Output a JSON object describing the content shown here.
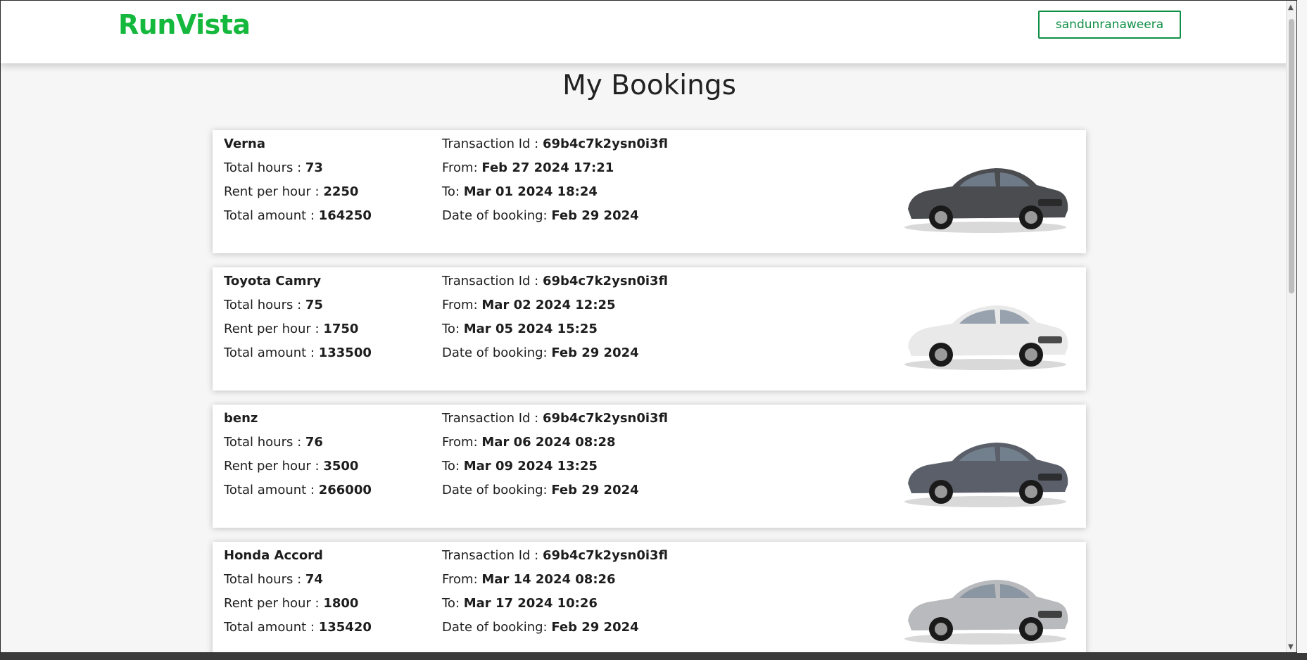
{
  "brand": {
    "name": "RunVista",
    "color": "#14b83c"
  },
  "header": {
    "user_label": "sandunranaweera"
  },
  "page": {
    "title": "My Bookings"
  },
  "labels": {
    "total_hours": "Total hours : ",
    "rent_per_hour": "Rent per hour : ",
    "total_amount": "Total amount : ",
    "transaction_id": "Transaction Id : ",
    "from": "From: ",
    "to": "To: ",
    "date_of_booking": "Date of booking: "
  },
  "bookings": [
    {
      "name": "Verna",
      "total_hours": "73",
      "rent_per_hour": "2250",
      "total_amount": "164250",
      "transaction_id": "69b4c7k2ysn0i3fl",
      "from": "Feb 27 2024 17:21",
      "to": "Mar 01 2024 18:24",
      "date_of_booking": "Feb 29 2024",
      "car_color": "#4a4c50",
      "car_icon": "dark-sedan-image"
    },
    {
      "name": "Toyota Camry",
      "total_hours": "75",
      "rent_per_hour": "1750",
      "total_amount": "133500",
      "transaction_id": "69b4c7k2ysn0i3fl",
      "from": "Mar 02 2024 12:25",
      "to": "Mar 05 2024 15:25",
      "date_of_booking": "Feb 29 2024",
      "car_color": "#e9e9ea",
      "car_icon": "white-sedan-image"
    },
    {
      "name": "benz",
      "total_hours": "76",
      "rent_per_hour": "3500",
      "total_amount": "266000",
      "transaction_id": "69b4c7k2ysn0i3fl",
      "from": "Mar 06 2024 08:28",
      "to": "Mar 09 2024 13:25",
      "date_of_booking": "Feb 29 2024",
      "car_color": "#5a5f69",
      "car_icon": "grey-sedan-image"
    },
    {
      "name": "Honda Accord",
      "total_hours": "74",
      "rent_per_hour": "1800",
      "total_amount": "135420",
      "transaction_id": "69b4c7k2ysn0i3fl",
      "from": "Mar 14 2024 08:26",
      "to": "Mar 17 2024 10:26",
      "date_of_booking": "Feb 29 2024",
      "car_color": "#b9babd",
      "car_icon": "silver-sedan-image"
    }
  ]
}
